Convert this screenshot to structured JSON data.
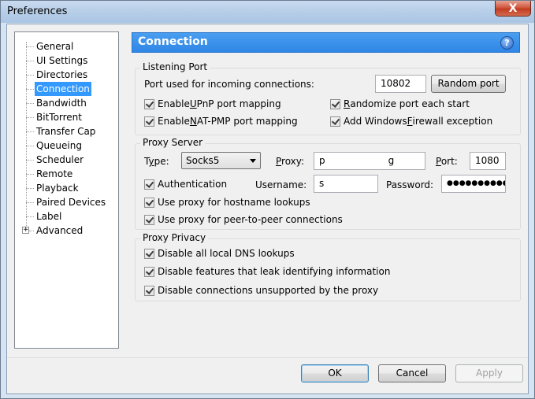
{
  "window": {
    "title": "Preferences",
    "close_label": "X"
  },
  "tree": {
    "items": [
      {
        "label": "General"
      },
      {
        "label": "UI Settings"
      },
      {
        "label": "Directories"
      },
      {
        "label": "Connection"
      },
      {
        "label": "Bandwidth"
      },
      {
        "label": "BitTorrent"
      },
      {
        "label": "Transfer Cap"
      },
      {
        "label": "Queueing"
      },
      {
        "label": "Scheduler"
      },
      {
        "label": "Remote"
      },
      {
        "label": "Playback"
      },
      {
        "label": "Paired Devices"
      },
      {
        "label": "Label"
      },
      {
        "label": "Advanced"
      }
    ],
    "selected": "Connection",
    "expander": "+"
  },
  "header": {
    "title": "Connection",
    "help_glyph": "?"
  },
  "listening_port": {
    "title": "Listening Port",
    "port_label": "Port used for incoming connections:",
    "port_value": "10802",
    "random_button": "Random port",
    "upnp": {
      "pre": "Enable ",
      "u": "U",
      "post": "PnP port mapping",
      "checked": true
    },
    "natpmp": {
      "pre": "Enable ",
      "u": "N",
      "post": "AT-PMP port mapping",
      "checked": true
    },
    "randomize": {
      "pre": "",
      "u": "R",
      "post": "andomize port each start",
      "checked": true
    },
    "firewall": {
      "pre": "Add Windows ",
      "u": "F",
      "post": "irewall exception",
      "checked": true
    }
  },
  "proxy_server": {
    "title": "Proxy Server",
    "type_label_pre": "T",
    "type_label_u": "y",
    "type_label_post": "pe:",
    "type_value": "Socks5",
    "proxy_label_pre": "",
    "proxy_label_u": "P",
    "proxy_label_post": "roxy:",
    "proxy_value_a": "p",
    "proxy_value_b": "g",
    "port_label_pre": "",
    "port_label_u": "P",
    "port_label_post": "ort:",
    "port_value": "1080",
    "auth": {
      "label": "Authentication",
      "checked": true
    },
    "username_label": "Username:",
    "username_value": "s",
    "password_label": "Password:",
    "password_value": "●●●●●●●●●●●",
    "hostname": {
      "label": "Use proxy for hostname lookups",
      "checked": true
    },
    "p2p": {
      "label": "Use proxy for peer-to-peer connections",
      "checked": true
    }
  },
  "proxy_privacy": {
    "title": "Proxy Privacy",
    "dns": {
      "label": "Disable all local DNS lookups",
      "checked": true
    },
    "leak": {
      "label": "Disable features that leak identifying information",
      "checked": true
    },
    "unsupported": {
      "label": "Disable connections unsupported by the proxy",
      "checked": true
    }
  },
  "buttons": {
    "ok": "OK",
    "cancel": "Cancel",
    "apply": "Apply"
  }
}
